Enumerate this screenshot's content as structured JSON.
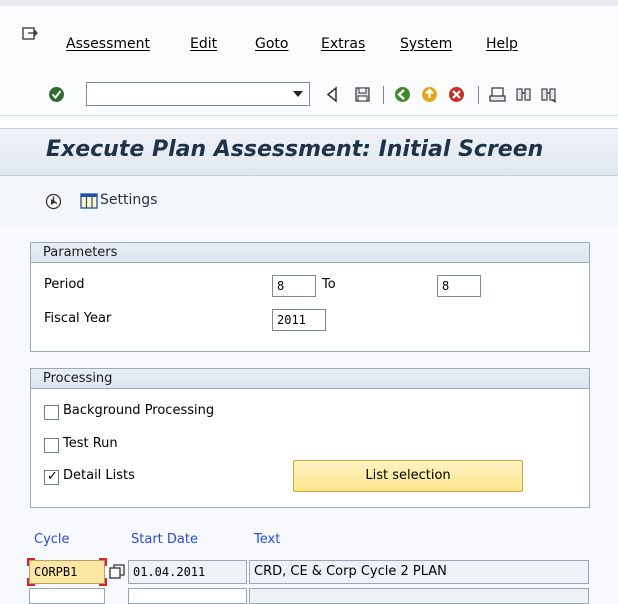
{
  "menu": {
    "items": [
      "Assessment",
      "Edit",
      "Goto",
      "Extras",
      "System",
      "Help"
    ]
  },
  "toolbar": {
    "command_value": ""
  },
  "title": "Execute Plan Assessment: Initial Screen",
  "app_toolbar": {
    "settings_label": "Settings"
  },
  "parameters": {
    "header": "Parameters",
    "period_label": "Period",
    "period_from": "8",
    "to_label": "To",
    "period_to": "8",
    "fiscal_year_label": "Fiscal Year",
    "fiscal_year": "2011"
  },
  "processing": {
    "header": "Processing",
    "background_label": "Background Processing",
    "background_checked": false,
    "test_run_label": "Test Run",
    "test_run_checked": false,
    "detail_lists_label": "Detail Lists",
    "detail_lists_checked": true,
    "list_selection_label": "List selection"
  },
  "cycle_table": {
    "headers": [
      "Cycle",
      "Start Date",
      "Text"
    ],
    "rows": [
      {
        "cycle": "CORPB1",
        "start_date": "01.04.2011",
        "text": "CRD, CE & Corp Cycle 2 PLAN"
      }
    ]
  },
  "colors": {
    "title_text": "#1f3347",
    "column_header": "#2a4bd7",
    "button_yellow": "#fde48a",
    "required_highlight": "#fbe6a2",
    "required_border": "#d8232a"
  }
}
